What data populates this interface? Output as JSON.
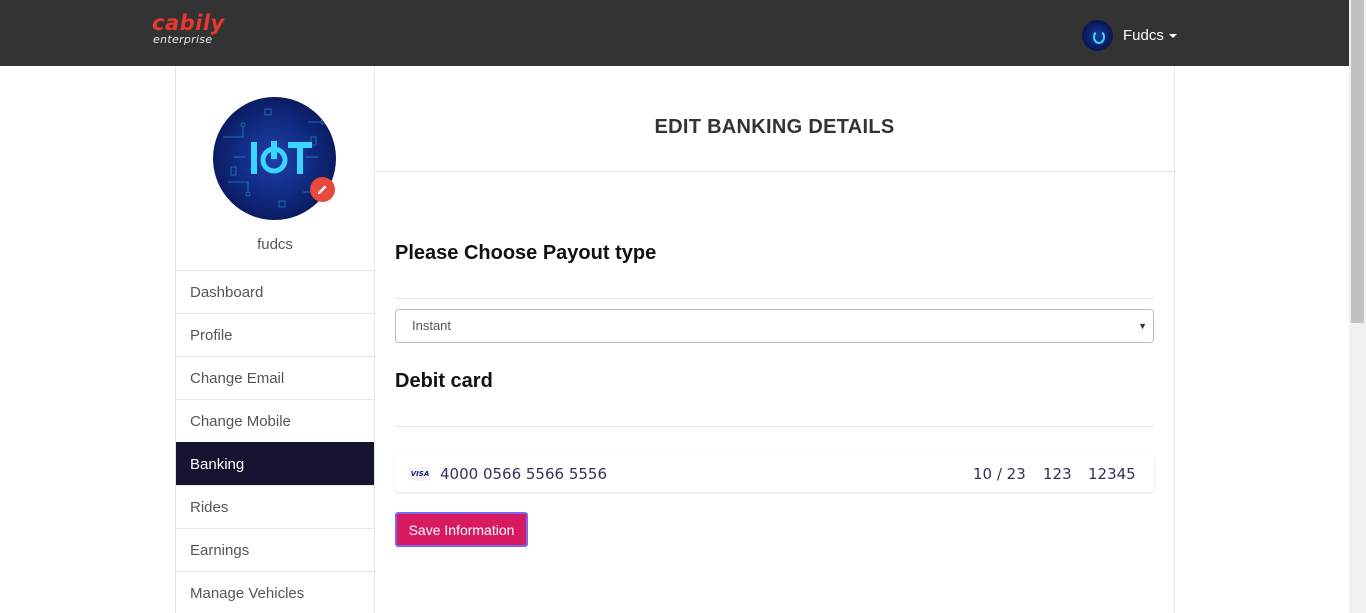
{
  "header": {
    "logo_main": "cabily",
    "logo_sub": "enterprise",
    "user_name": "Fudcs"
  },
  "sidebar": {
    "username": "fudcs",
    "items": [
      {
        "label": "Dashboard",
        "active": false
      },
      {
        "label": "Profile",
        "active": false
      },
      {
        "label": "Change Email",
        "active": false
      },
      {
        "label": "Change Mobile",
        "active": false
      },
      {
        "label": "Banking",
        "active": true
      },
      {
        "label": "Rides",
        "active": false
      },
      {
        "label": "Earnings",
        "active": false
      },
      {
        "label": "Manage Vehicles",
        "active": false
      }
    ]
  },
  "main": {
    "title": "EDIT BANKING DETAILS",
    "payout_heading": "Please Choose Payout type",
    "payout_select": {
      "value": "Instant"
    },
    "debit_heading": "Debit card",
    "card": {
      "brand": "VISA",
      "number": "4000 0566 5566 5556",
      "expiry": "10 / 23",
      "cvc": "123",
      "zip": "12345"
    },
    "save_label": "Save Information"
  },
  "colors": {
    "topbar": "#333333",
    "brand_red": "#e8372f",
    "active_nav": "#151430",
    "save_button": "#d81b60",
    "edit_badge": "#e8493b"
  }
}
